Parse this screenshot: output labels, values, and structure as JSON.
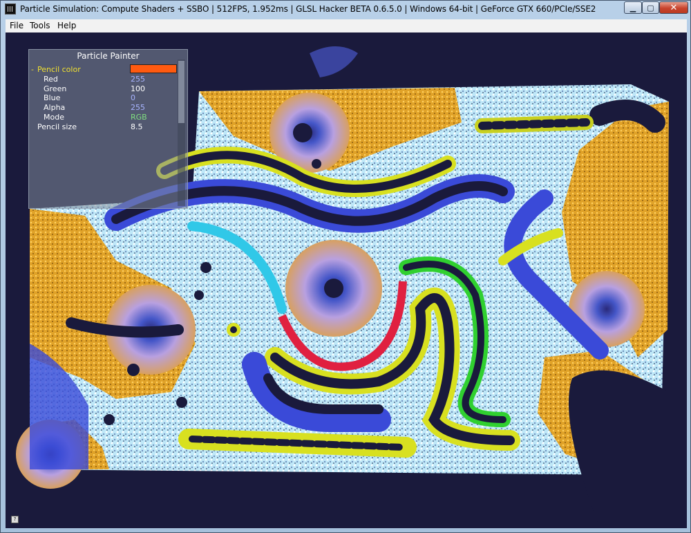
{
  "window": {
    "title": "Particle Simulation: Compute Shaders + SSBO | 512FPS, 1.952ms | GLSL Hacker BETA 0.6.5.0 | Windows 64-bit | GeForce GTX 660/PCIe/SSE2",
    "minimize_glyph": "▁",
    "maximize_glyph": "▢",
    "close_glyph": "✕"
  },
  "menu": {
    "file": "File",
    "tools": "Tools",
    "help": "Help"
  },
  "panel": {
    "title": "Particle Painter",
    "pencil_color_label": "Pencil color",
    "collapse_glyph": "-",
    "pencil_color_hex": "#ff5a10",
    "properties": [
      {
        "label": "Red",
        "value": "255"
      },
      {
        "label": "Green",
        "value": "100"
      },
      {
        "label": "Blue",
        "value": "0"
      },
      {
        "label": "Alpha",
        "value": "255"
      },
      {
        "label": "Mode",
        "value": "RGB"
      }
    ],
    "pencil_size_label": "Pencil size",
    "pencil_size_value": "8.5"
  },
  "colors": {
    "canvas_bg": "#1a1a3c",
    "accent_label": "#f0e030",
    "value_blue": "#a8b4ff",
    "value_green": "#80e080"
  },
  "status": {
    "icon": "?"
  }
}
